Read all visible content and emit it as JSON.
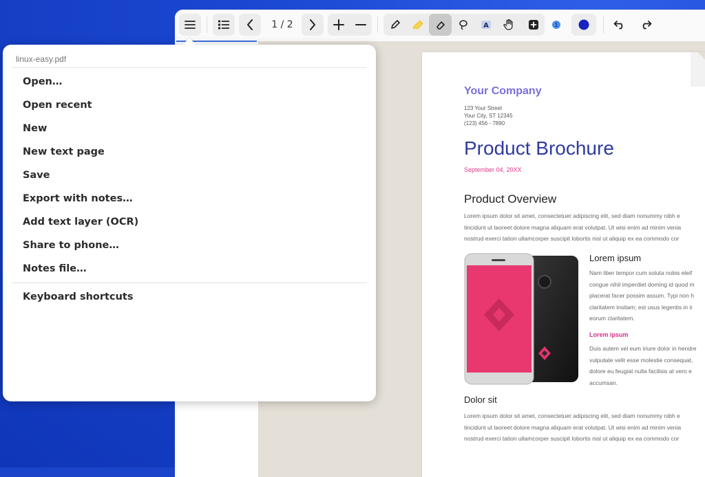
{
  "app": {
    "toolbar": {
      "page_indicator": "1 / 2",
      "buttons": [
        {
          "name": "main-menu"
        },
        {
          "name": "outline"
        },
        {
          "name": "previous-page"
        },
        {
          "name": "next-page"
        },
        {
          "name": "zoom-in"
        },
        {
          "name": "zoom-out"
        },
        {
          "name": "pen"
        },
        {
          "name": "highlighter"
        },
        {
          "name": "eraser"
        },
        {
          "name": "lasso"
        },
        {
          "name": "text"
        },
        {
          "name": "hand"
        },
        {
          "name": "add"
        },
        {
          "name": "stamp"
        },
        {
          "name": "color"
        },
        {
          "name": "undo"
        },
        {
          "name": "redo"
        }
      ],
      "active_tool": "eraser",
      "stamp_number": "1",
      "color_swatch": "#1a22c0"
    },
    "menu": {
      "filename": "linux-easy.pdf",
      "items": [
        "Open…",
        "Open recent",
        "New",
        "New text page",
        "Save",
        "Export with notes…",
        "Add text layer (OCR)",
        "Share to phone…",
        "Notes file…"
      ],
      "footer_item": "Keyboard shortcuts"
    }
  },
  "document": {
    "company": "Your Company",
    "address": [
      "123 Your Street",
      "Your City, ST 12345",
      "(123) 456 - 7890"
    ],
    "title": "Product Brochure",
    "date": "September 04, 20XX",
    "section1": {
      "heading": "Product Overview",
      "lines": [
        "Lorem ipsum dolor sit amet, consectetuer adipiscing elit, sed diam nonummy nibh e",
        "tincidunt ut laoreet dolore magna aliquam erat volutpat. Ut wisi enim ad minim venia",
        "nostrud exerci tation ullamcorper suscipit lobortis nisl ut aliquip ex ea commodo cor"
      ]
    },
    "side": {
      "heading": "Lorem ipsum",
      "lines": [
        "Nam liber tempor cum soluta nobis eleif",
        "congue nihil imperdiet doming id quod m",
        "placerat facer possim assum. Typi non h",
        "claritatem insitam; est usus legentis in ii",
        "eorum claritatem."
      ],
      "subheading": "Lorem ipsum",
      "lines2": [
        "Duis autem vel eum iriure dolor in hendre",
        "vulputate velit esse molestie consequat,",
        "dolore eu feugiat nulla facilisis at vero e",
        "accumsan."
      ]
    },
    "section2": {
      "heading": "Dolor sit",
      "lines": [
        "Lorem ipsum dolor sit amet, consectetuer adipiscing elit, sed diam nonummy nibh e",
        "tincidunt ut laoreet dolore magna aliquam erat volutpat. Ut wisi enim ad minim venia",
        "nostrud exerci tation ullamcorper suscipit lobortis nisl ut aliquip ex ea commodo cor"
      ]
    }
  }
}
